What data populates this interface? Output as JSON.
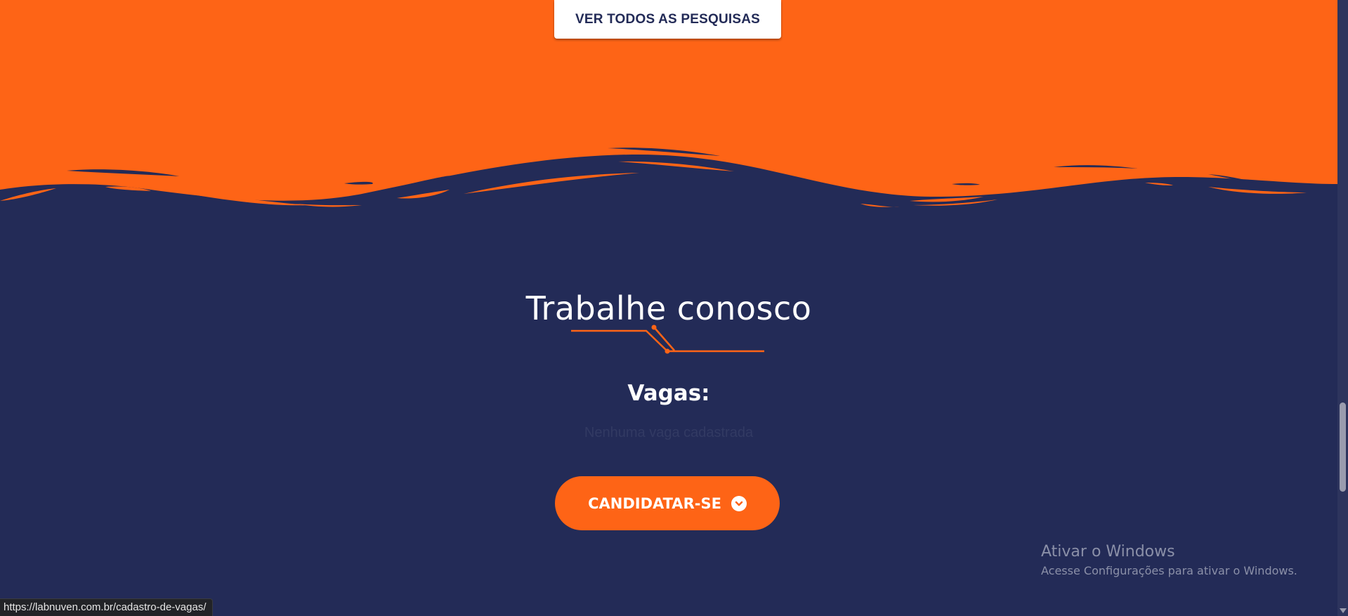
{
  "top_button": {
    "label": "VER TODOS AS PESQUISAS"
  },
  "section": {
    "title": "Trabalhe conosco",
    "vagas_heading": "Vagas:",
    "vagas_empty": "Nenhuma vaga cadastrada",
    "cta_label": "CANDIDATAR-SE"
  },
  "windows_watermark": {
    "title": "Ativar o Windows",
    "subtitle": "Acesse Configurações para ativar o Windows."
  },
  "status_bar": {
    "url": "https://labnuven.com.br/cadastro-de-vagas/"
  },
  "colors": {
    "orange": "#fe6416",
    "navy": "#232b57",
    "white": "#ffffff"
  },
  "icons": {
    "cta_icon": "chevron-down-circle-icon",
    "decor": "circuit-line-decoration"
  }
}
